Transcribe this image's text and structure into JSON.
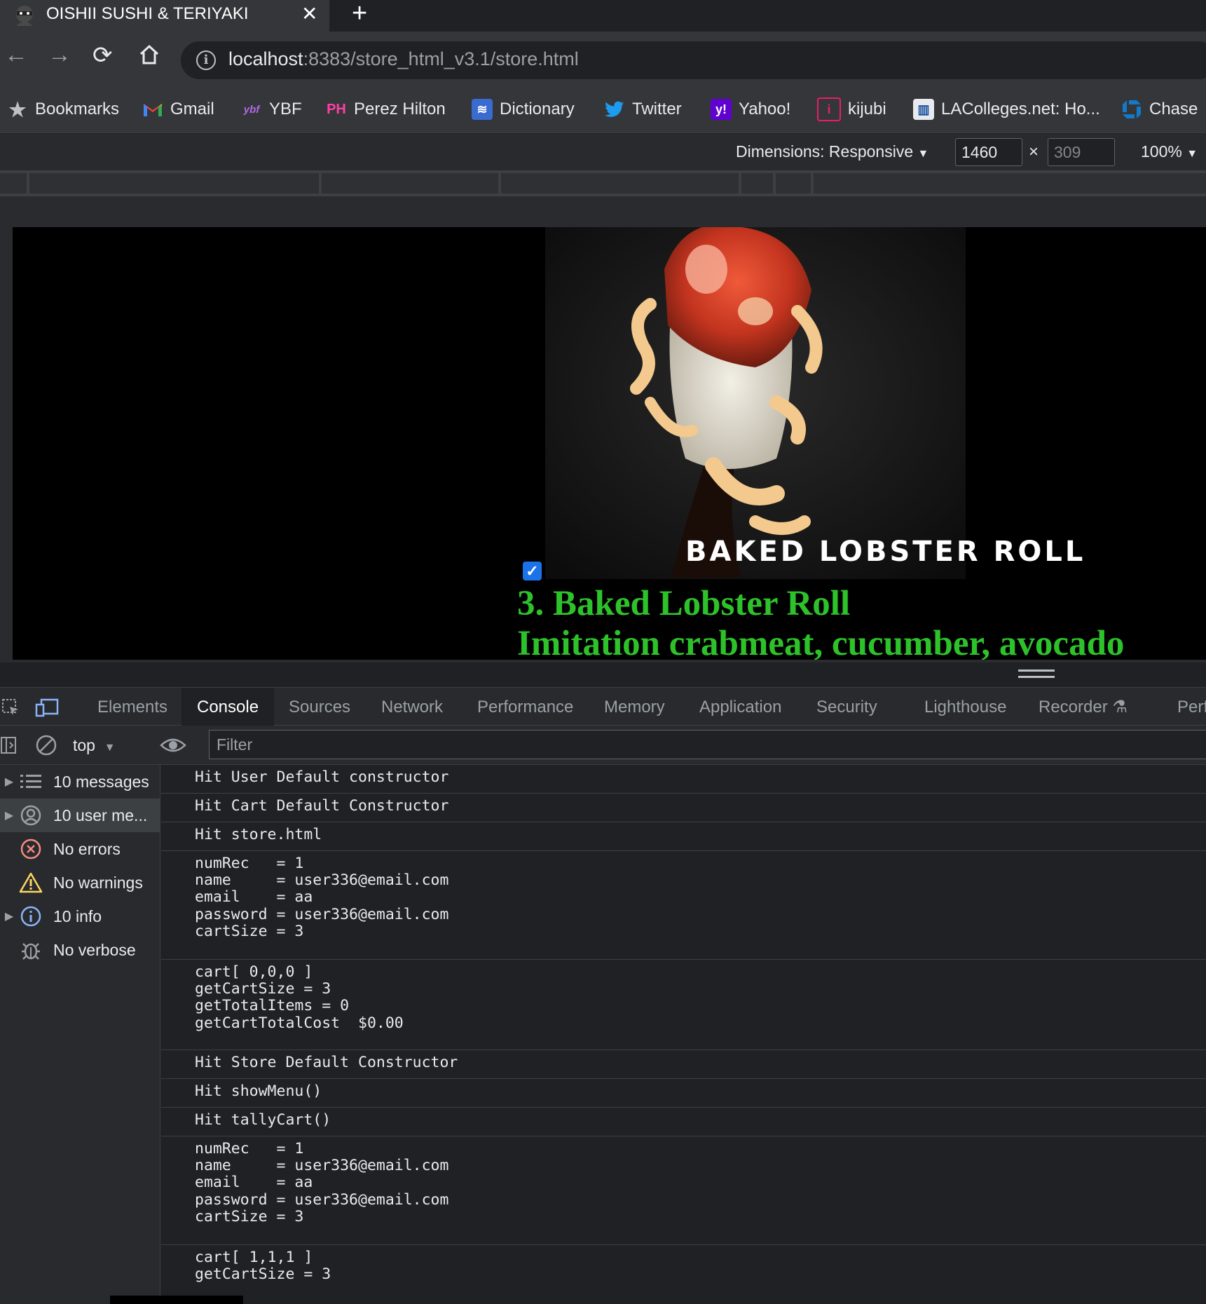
{
  "browser": {
    "tab": {
      "title": "OISHII SUSHI & TERIYAKI",
      "close_glyph": "✕"
    },
    "new_tab_glyph": "+",
    "nav": {
      "back": "←",
      "forward": "→",
      "reload": "⟳",
      "home": "⌂"
    },
    "url": {
      "host": "localhost",
      "rest": ":8383/store_html_v3.1/store.html"
    },
    "bookmarks": [
      {
        "label": "Bookmarks",
        "icon": "star-icon"
      },
      {
        "label": "Gmail",
        "icon": "gmail-icon"
      },
      {
        "label": "YBF",
        "icon": "ybf-icon"
      },
      {
        "label": "Perez Hilton",
        "icon": "perez-hilton-icon"
      },
      {
        "label": "Dictionary",
        "icon": "dictionary-icon"
      },
      {
        "label": "Twitter",
        "icon": "twitter-icon"
      },
      {
        "label": "Yahoo!",
        "icon": "yahoo-icon"
      },
      {
        "label": "kijubi",
        "icon": "kijubi-icon"
      },
      {
        "label": "LAColleges.net: Ho...",
        "icon": "lacolleges-icon"
      },
      {
        "label": "Chase",
        "icon": "chase-icon"
      }
    ]
  },
  "device_toolbar": {
    "dimensions_label": "Dimensions: Responsive",
    "width": "1460",
    "height": "309",
    "x_glyph": "×",
    "zoom": "100%"
  },
  "page": {
    "image_caption": "BAKED LOBSTER ROLL",
    "checkbox_checked": true,
    "item_title": "3. Baked Lobster Roll",
    "item_description": "Imitation crabmeat, cucumber, avocado"
  },
  "devtools": {
    "tabs": [
      "Elements",
      "Console",
      "Sources",
      "Network",
      "Performance",
      "Memory",
      "Application",
      "Security",
      "Lighthouse",
      "Recorder",
      "Perf"
    ],
    "active_tab": "Console",
    "context": "top",
    "filter_placeholder": "Filter",
    "sidebar": [
      {
        "label": "10 messages",
        "icon": "list-icon",
        "expandable": true
      },
      {
        "label": "10 user me...",
        "icon": "user-icon",
        "expandable": true
      },
      {
        "label": "No errors",
        "icon": "error-icon",
        "expandable": false
      },
      {
        "label": "No warnings",
        "icon": "warning-icon",
        "expandable": false
      },
      {
        "label": "10 info",
        "icon": "info-icon",
        "expandable": true
      },
      {
        "label": "No verbose",
        "icon": "bug-icon",
        "expandable": false
      }
    ],
    "messages": [
      "Hit User Default constructor",
      "Hit Cart Default Constructor",
      "Hit store.html",
      "numRec   = 1\nname     = user336@email.com\nemail    = aa\npassword = user336@email.com\ncartSize = 3",
      "cart[ 0,0,0 ]\ngetCartSize = 3\ngetTotalItems = 0\ngetCartTotalCost  $0.00",
      "Hit Store Default Constructor",
      "Hit showMenu()",
      "Hit tallyCart()",
      "numRec   = 1\nname     = user336@email.com\nemail    = aa\npassword = user336@email.com\ncartSize = 3",
      "cart[ 1,1,1 ]\ngetCartSize = 3"
    ]
  },
  "colors": {
    "item_text": "#2ec22a",
    "checkbox": "#1a73e8",
    "chrome_dark": "#202124",
    "chrome_mid": "#35363a"
  }
}
